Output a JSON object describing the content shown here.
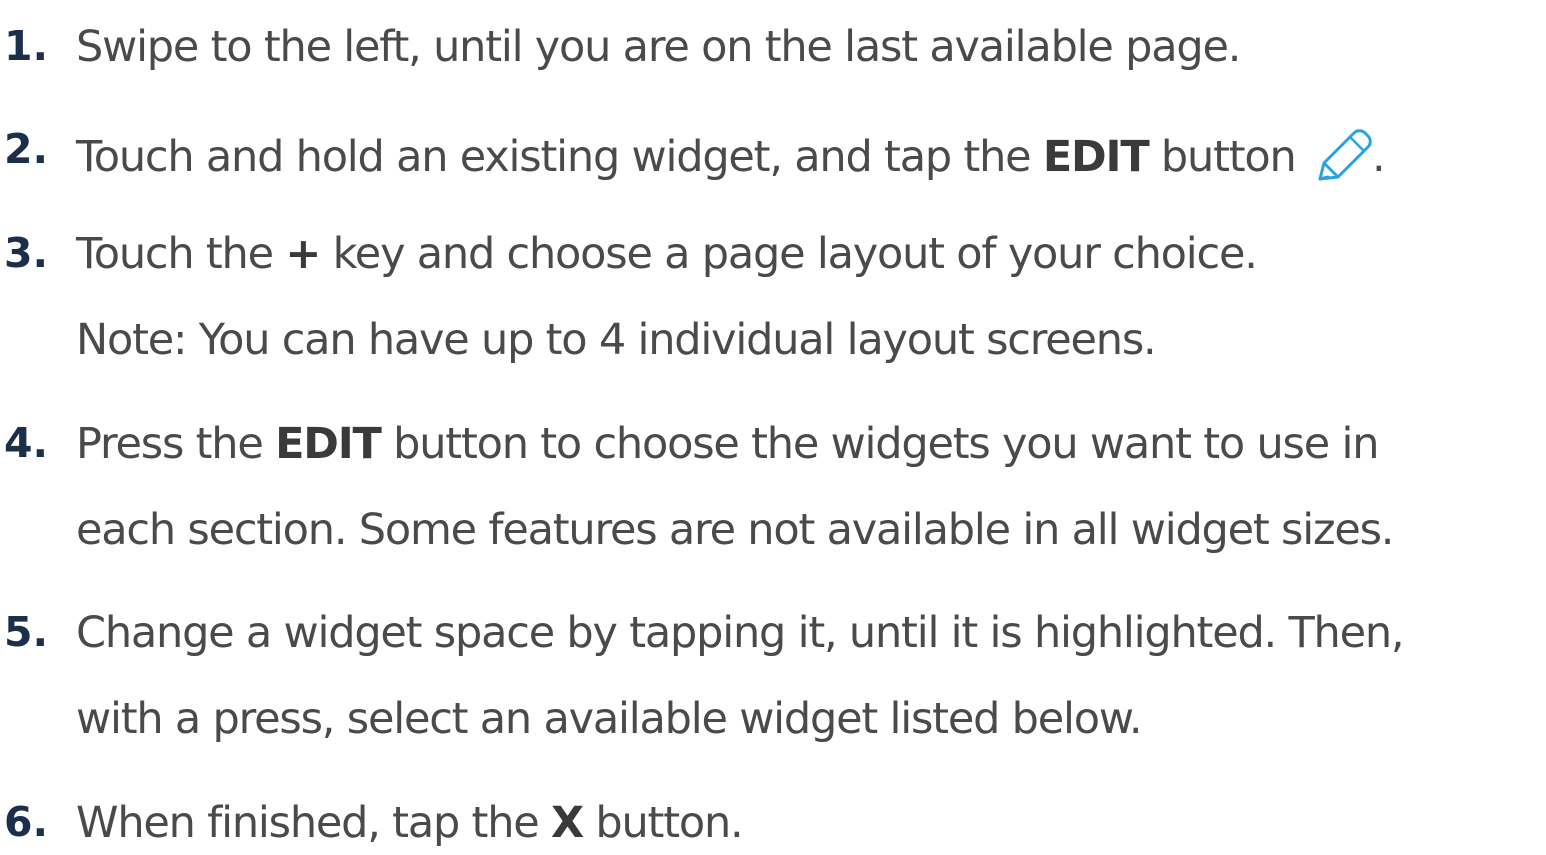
{
  "steps": [
    {
      "number": "1.",
      "lines": [
        {
          "parts": [
            {
              "text": "Swipe to the left, until you are on the last available page."
            }
          ]
        }
      ]
    },
    {
      "number": "2.",
      "lines": [
        {
          "parts": [
            {
              "text": "Touch and hold an existing widget, and tap the "
            },
            {
              "text": "EDIT",
              "bold": true
            },
            {
              "text": " button "
            },
            {
              "icon": "pencil-icon"
            },
            {
              "text": "."
            }
          ]
        }
      ]
    },
    {
      "number": "3.",
      "lines": [
        {
          "parts": [
            {
              "text": "Touch the "
            },
            {
              "text": "+",
              "bold": true
            },
            {
              "text": " key and choose a page layout of your choice."
            }
          ]
        },
        {
          "parts": [
            {
              "text": "Note: You can have up to 4 individual layout screens."
            }
          ]
        }
      ]
    },
    {
      "number": "4.",
      "lines": [
        {
          "parts": [
            {
              "text": "Press the "
            },
            {
              "text": "EDIT",
              "bold": true
            },
            {
              "text": " button to choose the widgets you want to use in"
            }
          ]
        },
        {
          "parts": [
            {
              "text": "each section. Some features are not available in all widget sizes."
            }
          ]
        }
      ]
    },
    {
      "number": "5.",
      "lines": [
        {
          "parts": [
            {
              "text": "Change a widget space by tapping it, until it is highlighted. Then,"
            }
          ]
        },
        {
          "parts": [
            {
              "text": "with a press, select an available widget listed below."
            }
          ]
        }
      ]
    },
    {
      "number": "6.",
      "lines": [
        {
          "parts": [
            {
              "text": "When finished, tap the "
            },
            {
              "text": "X",
              "bold": true
            },
            {
              "text": " button."
            }
          ]
        }
      ]
    }
  ],
  "colors": {
    "number": "#1c2f4a",
    "text": "#4a4a4a",
    "bold": "#3a3a3a",
    "icon": "#29a3e0"
  }
}
